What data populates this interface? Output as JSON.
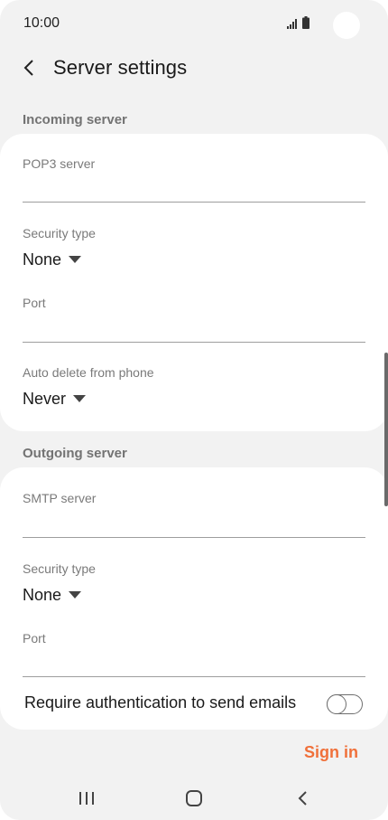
{
  "status_bar": {
    "time": "10:00",
    "icons": [
      "signal-icon",
      "battery-icon"
    ]
  },
  "header": {
    "title": "Server settings",
    "back_icon": "chevron-left-icon"
  },
  "incoming": {
    "section_title": "Incoming server",
    "server_label": "POP3 server",
    "server_value": "",
    "security_label": "Security type",
    "security_value": "None",
    "port_label": "Port",
    "port_value": "",
    "auto_delete_label": "Auto delete from phone",
    "auto_delete_value": "Never"
  },
  "outgoing": {
    "section_title": "Outgoing server",
    "server_label": "SMTP server",
    "server_value": "",
    "security_label": "Security type",
    "security_value": "None",
    "port_label": "Port",
    "port_value": "",
    "auth_label": "Require authentication to send emails",
    "auth_enabled": false
  },
  "actions": {
    "sign_in_label": "Sign in"
  },
  "nav": {
    "icons": [
      "recent-apps-icon",
      "home-icon",
      "back-icon"
    ]
  },
  "colors": {
    "accent": "#f0703a",
    "background": "#f2f2f2",
    "card": "#ffffff"
  }
}
